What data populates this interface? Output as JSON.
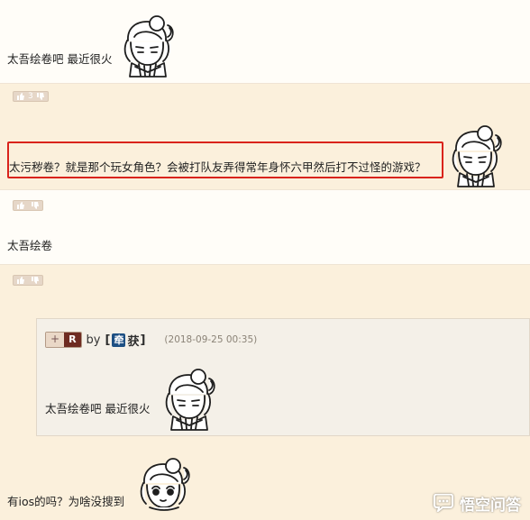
{
  "posts": [
    {
      "text": "太吾绘卷吧 最近很火"
    },
    {
      "text": "太污秽卷？就是那个玩女角色？会被打队友弄得常年身怀六甲然后打不过怪的游戏？"
    },
    {
      "text": "太吾绘卷"
    },
    {
      "text": "有ios的吗？为啥没搜到"
    }
  ],
  "votes": [
    {
      "count": "3"
    },
    {
      "count": ""
    },
    {
      "count": ""
    }
  ],
  "quote": {
    "plus": "+",
    "rank": "R",
    "by": "by",
    "bracket_left": "[",
    "badge": "牵",
    "username": "获",
    "bracket_right": "]",
    "date": "(2018-09-25 00:35)",
    "text": "太吾绘卷吧 最近很火"
  },
  "watermark": {
    "text": "悟空问答"
  },
  "colors": {
    "highlight_border": "#d9231b",
    "quote_background": "#f4f0e8",
    "band_background": "#fbf0dc",
    "rank_badge": "#6e2b21"
  }
}
